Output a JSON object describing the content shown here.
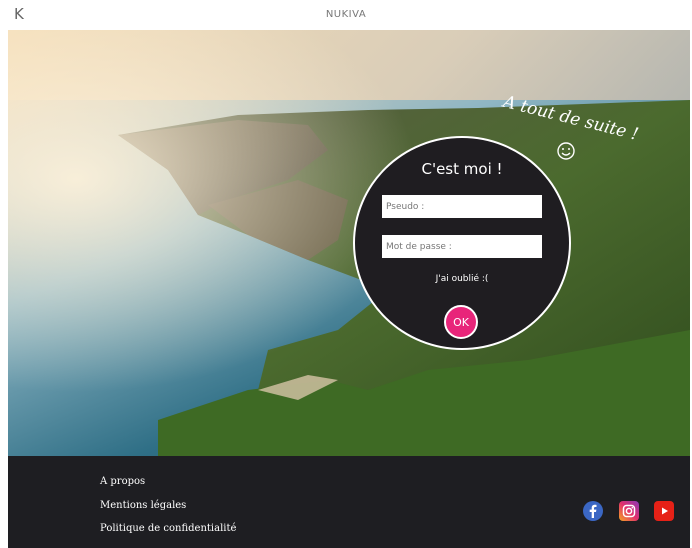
{
  "header": {
    "logo": "K",
    "brand": "NUKIVA"
  },
  "hero": {
    "greeting": "A tout de suite !",
    "smile_icon": "smile-icon"
  },
  "login": {
    "title": "C'est moi !",
    "username_placeholder": "Pseudo :",
    "password_placeholder": "Mot de passe :",
    "forgot_label": "J'ai oublié :(",
    "submit_label": "OK",
    "accent_color": "#e8257a"
  },
  "footer": {
    "links": [
      "A propos",
      "Mentions légales",
      "Politique de confidentialité"
    ],
    "social_icons": [
      "facebook-icon",
      "instagram-icon",
      "youtube-icon"
    ]
  }
}
